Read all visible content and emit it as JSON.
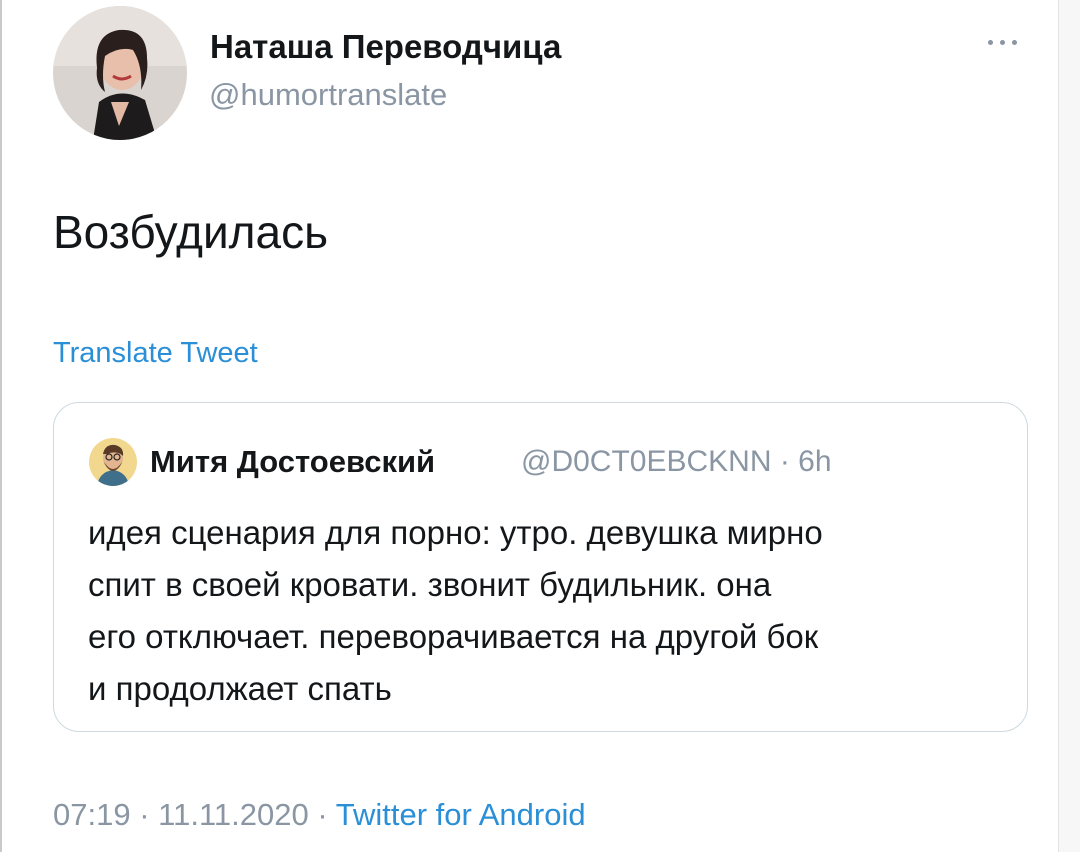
{
  "tweet": {
    "author": {
      "display_name": "Наташа Переводчица",
      "handle": "@humortranslate",
      "avatar_icon": "profile-photo"
    },
    "more_icon": "more-horizontal-icon",
    "text": "Возбудилась",
    "translate_label": "Translate Tweet",
    "quoted": {
      "author_name": "Митя Достоевский",
      "meta": "@D0CT0EBCKNN · 6h",
      "avatar_icon": "profile-photo",
      "lines": [
        "идея сценария для порно: утро. девушка мирно",
        "спит в своей кровати. звонит будильник. она",
        "его отключает. переворачивается на другой бок",
        "и продолжает спать"
      ]
    },
    "footer": {
      "time": "07:19",
      "separator": "·",
      "date": "11.11.2020",
      "source": "Twitter for Android"
    }
  },
  "colors": {
    "text_primary": "#14171a",
    "text_secondary": "#8a96a3",
    "link": "#2a8fd6",
    "card_border": "#cfd9de"
  }
}
